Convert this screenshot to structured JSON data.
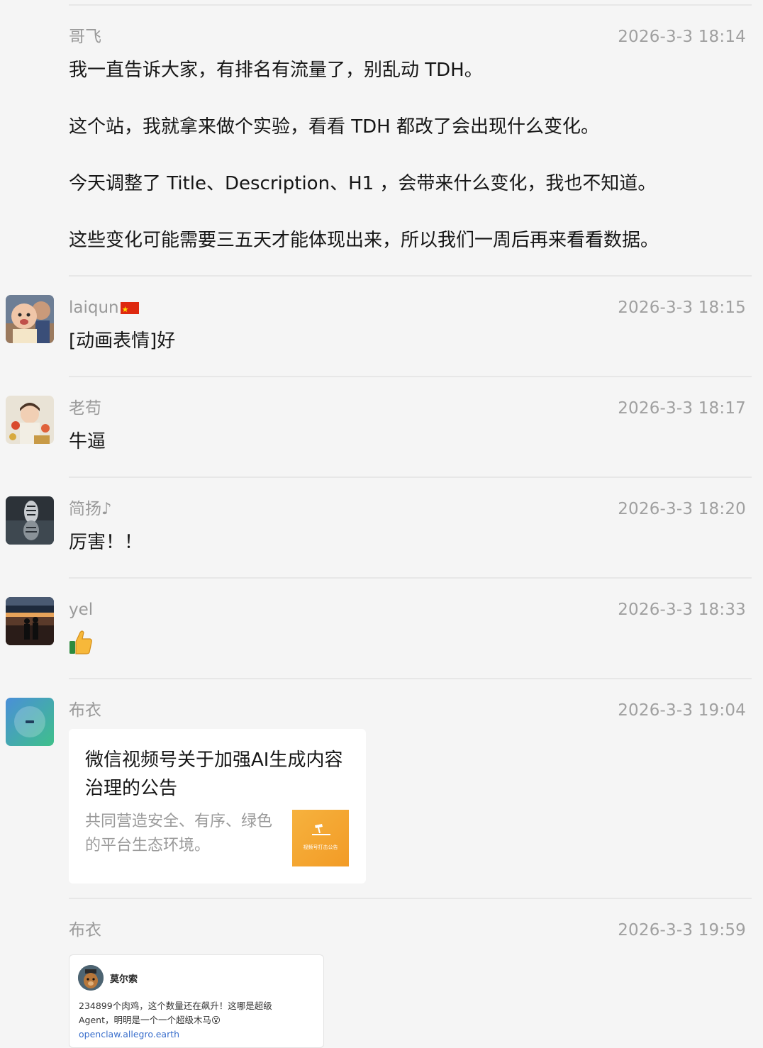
{
  "messages": [
    {
      "sender": "哥飞",
      "time": "2026-3-3 18:14",
      "lines": [
        "我一直告诉大家，有排名有流量了，别乱动 TDH。",
        "这个站，我就拿来做个实验，看看 TDH 都改了会出现什么变化。",
        "今天调整了 Title、Description、H1 ，会带来什么变化，我也不知道。",
        "这些变化可能需要三五天才能体现出来，所以我们一周后再来看看数据。"
      ]
    },
    {
      "sender": "laiqun",
      "flag": "china-flag-emoji",
      "time": "2026-3-3 18:15",
      "text": "[动画表情]好",
      "avatar": "baby-photo"
    },
    {
      "sender": "老苟",
      "time": "2026-3-3 18:17",
      "text": "牛逼",
      "avatar": "child-photo"
    },
    {
      "sender": "简扬♪",
      "time": "2026-3-3 18:20",
      "text": "厉害！！",
      "avatar": "tiger-reflection-photo"
    },
    {
      "sender": "yel",
      "time": "2026-3-3 18:33",
      "text": "",
      "emoji": "thumbs-up-icon",
      "avatar": "couple-silhouette-photo"
    },
    {
      "sender": "布衣",
      "time": "2026-3-3 19:04",
      "avatar": "teal-gradient-avatar",
      "card": {
        "title": "微信视频号关于加强AI生成内容治理的公告",
        "description": "共同营造安全、有序、绿色的平台生态环境。",
        "thumb_text": "视频号打击公告"
      }
    },
    {
      "sender": "布衣",
      "time": "2026-3-3 19:59",
      "screenshot": {
        "name": "莫尔索",
        "text_line1": "234899个肉鸡，这个数量还在飙升！这哪是超级",
        "text_line2": "Agent，明明是一个一个超级木马😮",
        "link": "openclaw.allegro.earth"
      }
    }
  ],
  "colors": {
    "background": "#f5f5f5",
    "card_thumb": "#f4a733"
  }
}
